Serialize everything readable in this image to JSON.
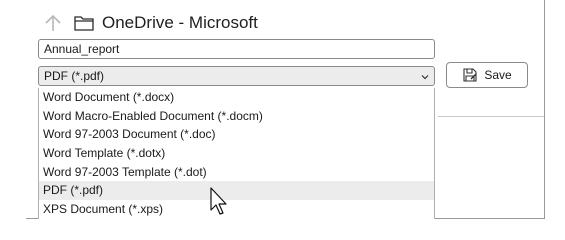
{
  "path": {
    "location": "OneDrive - Microsoft"
  },
  "filename": {
    "value": "Annual_report"
  },
  "filetype": {
    "selected": "PDF (*.pdf)"
  },
  "save": {
    "label": "Save"
  },
  "dropdown": {
    "options": [
      "Word Document (*.docx)",
      "Word Macro-Enabled Document (*.docm)",
      "Word 97-2003 Document (*.doc)",
      "Word Template (*.dotx)",
      "Word 97-2003 Template (*.dot)",
      "PDF (*.pdf)",
      "XPS Document (*.xps)"
    ],
    "hovered_index": 5
  },
  "icons": [
    "up-arrow-icon",
    "folder-icon",
    "chevron-down-icon",
    "save-icon",
    "mouse-pointer-icon"
  ]
}
